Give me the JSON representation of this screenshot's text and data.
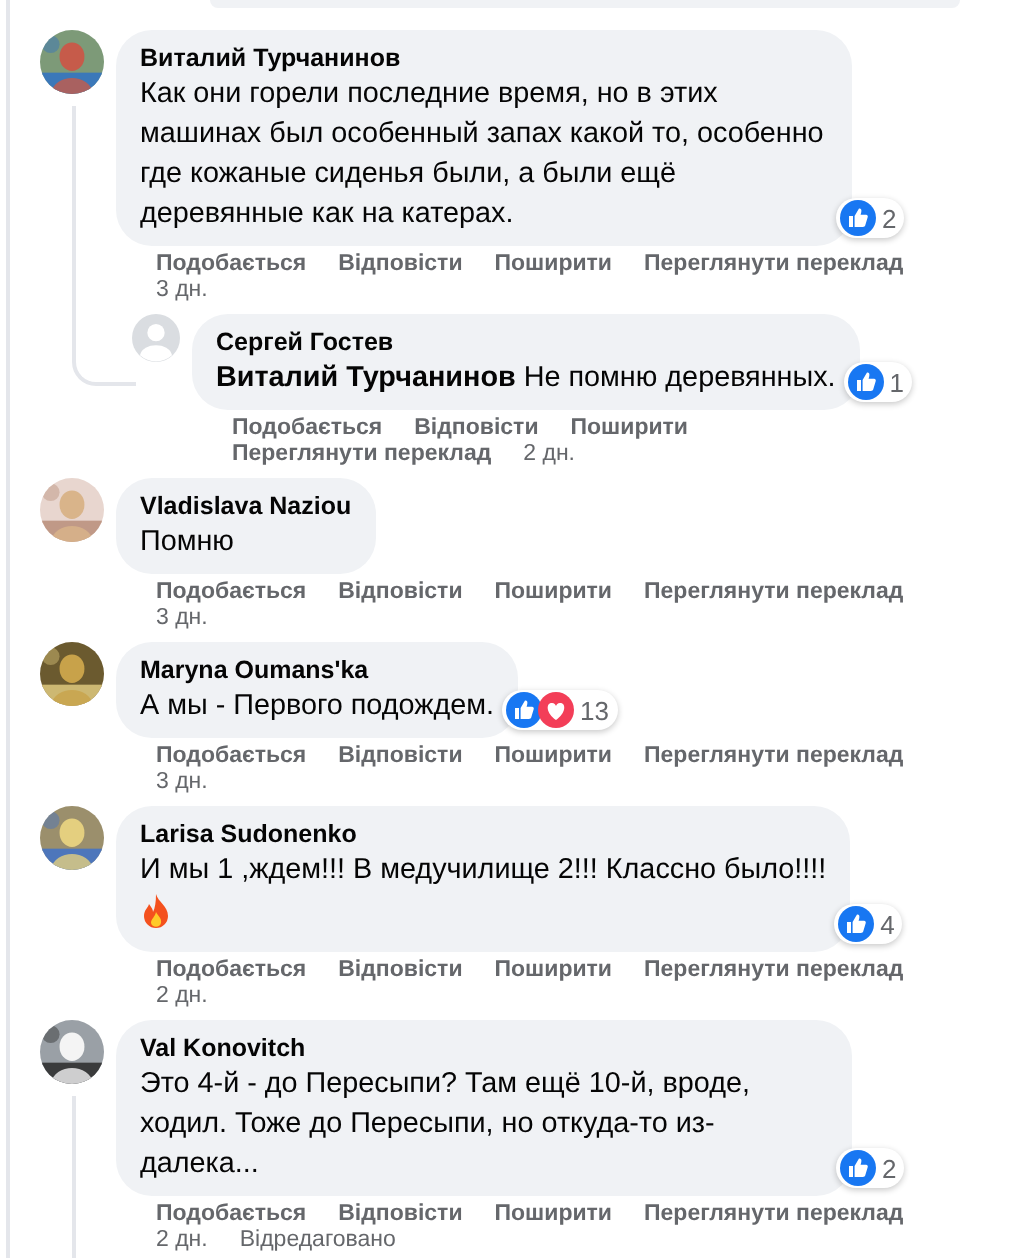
{
  "comments": [
    {
      "author": "Виталий Турчанинов",
      "avatar": {
        "kind": "picture"
      },
      "text": "Как они горели последние время, но в этих машинах был особенный запах какой то, особенно где кожаные сиденья были, а были ещё деревянные как на катерах.",
      "fire_emoji": false,
      "reactions": {
        "icons": [
          {
            "kind": "like"
          }
        ],
        "count": "2"
      },
      "actions": [
        "Подобається",
        "Відповісти",
        "Поширити",
        "Переглянути переклад"
      ],
      "time": "3 дн.",
      "replies": [
        {
          "author": "Сергей Гостев",
          "avatar": {
            "kind": "default"
          },
          "text": "**Виталий Турчанинов** Не помню деревянных.",
          "reactions": {
            "icons": [
              {
                "kind": "like"
              }
            ],
            "count": "1"
          },
          "actions": [
            "Подобається",
            "Відповісти",
            "Поширити",
            "Переглянути переклад"
          ],
          "time": "2 дн."
        }
      ]
    },
    {
      "author": "Vladislava Naziou",
      "avatar": {
        "kind": "picture"
      },
      "text": "Помню",
      "fire_emoji": false,
      "actions": [
        "Подобається",
        "Відповісти",
        "Поширити",
        "Переглянути переклад"
      ],
      "time": "3 дн."
    },
    {
      "author": "Maryna Oumans'ka",
      "avatar": {
        "kind": "picture"
      },
      "text": "А мы - Первого подождем.",
      "fire_emoji": false,
      "reactions": {
        "icons": [
          {
            "kind": "like"
          },
          {
            "kind": "love"
          }
        ],
        "count": "13"
      },
      "actions": [
        "Подобається",
        "Відповісти",
        "Поширити",
        "Переглянути переклад"
      ],
      "time": "3 дн."
    },
    {
      "author": "Larisa Sudonenko",
      "avatar": {
        "kind": "picture"
      },
      "text": "И мы 1 ,ждем!!! В медучилище 2!!! Классно было!!!!",
      "fire_emoji": true,
      "reactions": {
        "icons": [
          {
            "kind": "like"
          }
        ],
        "count": "4"
      },
      "actions": [
        "Подобається",
        "Відповісти",
        "Поширити",
        "Переглянути переклад"
      ],
      "time": "2 дн."
    },
    {
      "author": "Val Konovitch",
      "avatar": {
        "kind": "picture"
      },
      "text": "Это 4-й - до Пересыпи? Там ещё 10-й, вроде, ходил. Тоже до Пересыпи, но откуда-то из-далека...",
      "fire_emoji": false,
      "reactions": {
        "icons": [
          {
            "kind": "like"
          }
        ],
        "count": "2"
      },
      "actions": [
        "Подобається",
        "Відповісти",
        "Поширити",
        "Переглянути переклад"
      ],
      "time": "2 дн.",
      "edited_label": "Відредаговано",
      "thread_continues": true
    }
  ]
}
